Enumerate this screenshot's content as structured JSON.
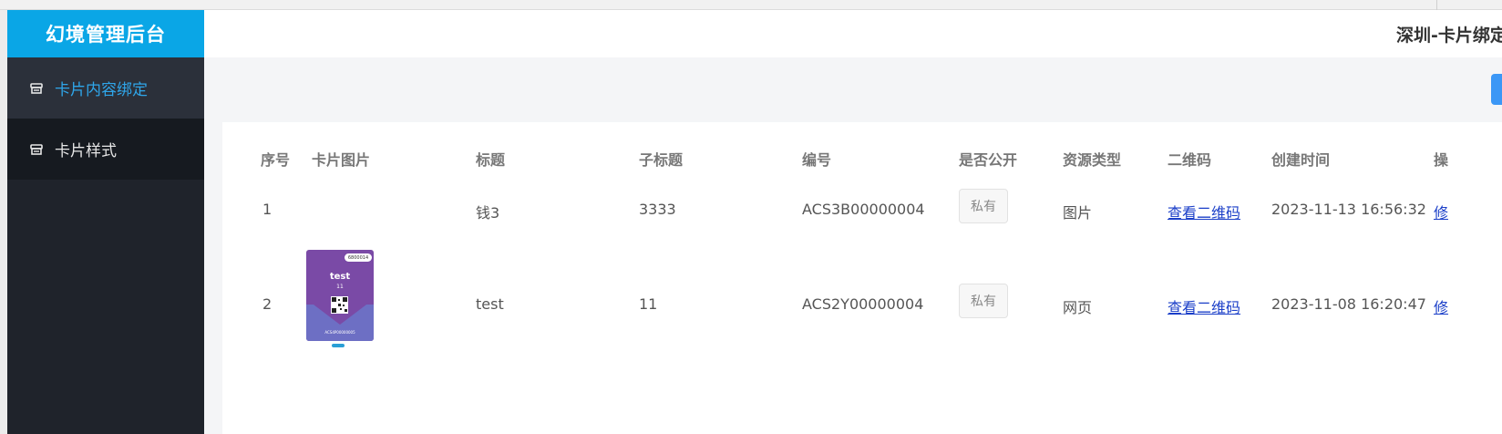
{
  "sidebar": {
    "brand": "幻境管理后台",
    "items": [
      {
        "label": "卡片内容绑定"
      },
      {
        "label": "卡片样式"
      }
    ]
  },
  "header": {
    "title": "深圳-卡片绑定"
  },
  "table": {
    "headers": [
      "序号",
      "卡片图片",
      "标题",
      "子标题",
      "编号",
      "是否公开",
      "资源类型",
      "二维码",
      "创建时间",
      "操"
    ],
    "rows": [
      {
        "index": "1",
        "title": "钱3",
        "subtitle": "3333",
        "code": "ACS3B00000004",
        "visibility": "私有",
        "resource_type": "图片",
        "qr_link": "查看二维码",
        "created": "2023-11-13 16:56:32",
        "action": "修"
      },
      {
        "index": "2",
        "title": "test",
        "subtitle": "11",
        "code": "ACS2Y00000004",
        "visibility": "私有",
        "resource_type": "网页",
        "qr_link": "查看二维码",
        "created": "2023-11-08 16:20:47",
        "action": "修",
        "thumbnail": {
          "badge": "6800014",
          "title": "test",
          "subtitle": "11",
          "code": "ACS4P00000005",
          "icon": "qr-code-icon"
        }
      }
    ]
  },
  "colors": {
    "brand": "#0aa6e6",
    "sidebar_bg": "#1f232b",
    "active_text": "#2fa6ea",
    "link": "#1a3ec8",
    "card_purple": "#7a4aa6",
    "button_blue": "#3b97f6"
  }
}
